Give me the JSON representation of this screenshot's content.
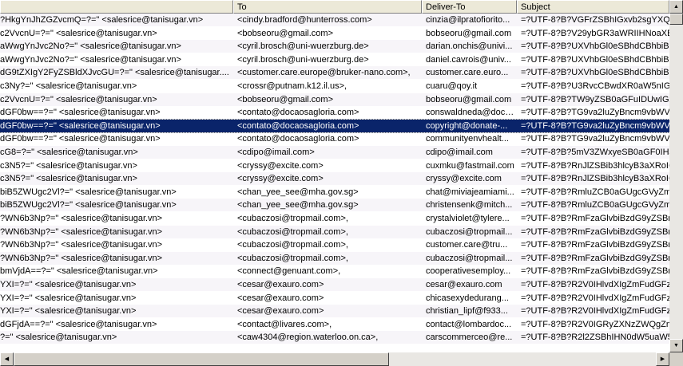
{
  "columns": [
    {
      "label": ""
    },
    {
      "label": "To"
    },
    {
      "label": "Deliver-To"
    },
    {
      "label": "Subject"
    }
  ],
  "rows": [
    {
      "from": "?HkgYnJhZGZvcmQ=?=\" <salesrice@tanisugar.vn>",
      "to": "<cindy.bradford@hunterross.com>",
      "deliver_to": "cinzia@ilpratofiorito...",
      "subject": "=?UTF-8?B?VGFrZSBhIGxvb2sgYXQgb"
    },
    {
      "from": "c2VvcnU=?=\" <salesrice@tanisugar.vn>",
      "to": "<bobseoru@gmail.com>",
      "deliver_to": "bobseoru@gmail.com",
      "subject": "=?UTF-8?B?V29ybGR3aWRIIHNoaXBwa"
    },
    {
      "from": "aWwgYnJvc2No?=\" <salesrice@tanisugar.vn>",
      "to": "<cyril.brosch@uni-wuerzburg.de>",
      "deliver_to": "darian.onchis@univi...",
      "subject": "=?UTF-8?B?UXVhbGl0eSBhdCBhbiBhZ"
    },
    {
      "from": "aWwgYnJvc2No?=\" <salesrice@tanisugar.vn>",
      "to": "<cyril.brosch@uni-wuerzburg.de>",
      "deliver_to": "daniel.cavrois@univ...",
      "subject": "=?UTF-8?B?UXVhbGl0eSBhdCBhbiBhZ"
    },
    {
      "from": "dG9tZXIgY2FyZSBldXJvcGU=?=\" <salesrice@tanisugar....",
      "to": "<customer.care.europe@bruker-nano.com>,",
      "deliver_to": "customer.care.euro...",
      "subject": "=?UTF-8?B?UXVhbGl0eSBhdCBhbiBhZ"
    },
    {
      "from": "c3Ny?=\" <salesrice@tanisugar.vn>",
      "to": "<crossr@putnam.k12.il.us>,",
      "deliver_to": "cuaru@qoy.it",
      "subject": "=?UTF-8?B?U3RvcCBwdXR0aW5nIGl0"
    },
    {
      "from": "c2VvcnU=?=\" <salesrice@tanisugar.vn>",
      "to": "<bobseoru@gmail.com>",
      "deliver_to": "bobseoru@gmail.com",
      "subject": "=?UTF-8?B?TW9yZSB0aGFuIDUwIGx"
    },
    {
      "from": "dGF0bw==?=\" <salesrice@tanisugar.vn>",
      "to": "<contato@docaosagloria.com>",
      "deliver_to": "conswaldneda@doca...",
      "subject": "=?UTF-8?B?TG9va2luZyBncm9vbWVk"
    },
    {
      "from": "dGF0bw==?=\" <salesrice@tanisugar.vn>",
      "to": "<contato@docaosagloria.com>",
      "deliver_to": "copyright@donate-...",
      "subject": "=?UTF-8?B?TG9va2luZyBncm9vbWVk"
    },
    {
      "from": "dGF0bw==?=\" <salesrice@tanisugar.vn>",
      "to": "<contato@docaosagloria.com>",
      "deliver_to": "communityenvhealt...",
      "subject": "=?UTF-8?B?TG9va2luZyBncm9vbWVk"
    },
    {
      "from": "cG8=?=\" <salesrice@tanisugar.vn>",
      "to": "<cdipo@imail.com>",
      "deliver_to": "cdipo@imail.com",
      "subject": "=?UTF-8?B?5mV3ZWxyeSB0aGF0IHJl"
    },
    {
      "from": "c3N5?=\" <salesrice@tanisugar.vn>",
      "to": "<cryssy@excite.com>",
      "deliver_to": "cuxmku@fastmail.com",
      "subject": "=?UTF-8?B?RnJlZSBib3hlcyB3aXRoIGl"
    },
    {
      "from": "c3N5?=\" <salesrice@tanisugar.vn>",
      "to": "<cryssy@excite.com>",
      "deliver_to": "cryssy@excite.com",
      "subject": "=?UTF-8?B?RnJlZSBib3hlcyB3aXRoIGl"
    },
    {
      "from": "biB5ZWUgc2Vl?=\" <salesrice@tanisugar.vn>",
      "to": "<chan_yee_see@mha.gov.sg>",
      "deliver_to": "chat@miviajeamiami...",
      "subject": "=?UTF-8?B?RmluZCB0aGUgcGVyZmVj"
    },
    {
      "from": "biB5ZWUgc2Vl?=\" <salesrice@tanisugar.vn>",
      "to": "<chan_yee_see@mha.gov.sg>",
      "deliver_to": "christensenk@mitch...",
      "subject": "=?UTF-8?B?RmluZCB0aGUgcGVyZmVj"
    },
    {
      "from": "?WN6b3Np?=\" <salesrice@tanisugar.vn>",
      "to": "<cubaczosi@tropmail.com>,",
      "deliver_to": "crystalviolet@tylere...",
      "subject": "=?UTF-8?B?RmFzaGlvbiBzdG9yZSBnY"
    },
    {
      "from": "?WN6b3Np?=\" <salesrice@tanisugar.vn>",
      "to": "<cubaczosi@tropmail.com>,",
      "deliver_to": "cubaczosi@tropmail...",
      "subject": "=?UTF-8?B?RmFzaGlvbiBzdG9yZSBnY"
    },
    {
      "from": "?WN6b3Np?=\" <salesrice@tanisugar.vn>",
      "to": "<cubaczosi@tropmail.com>,",
      "deliver_to": "customer.care@tru...",
      "subject": "=?UTF-8?B?RmFzaGlvbiBzdG9yZSBnY"
    },
    {
      "from": "?WN6b3Np?=\" <salesrice@tanisugar.vn>",
      "to": "<cubaczosi@tropmail.com>,",
      "deliver_to": "cubaczosi@tropmail...",
      "subject": "=?UTF-8?B?RmFzaGlvbiBzdG9yZSBnY"
    },
    {
      "from": "bmVjdA==?=\" <salesrice@tanisugar.vn>",
      "to": "<connect@genuant.com>,",
      "deliver_to": "cooperativesemploy...",
      "subject": "=?UTF-8?B?RmFzaGlvbiBzdG9yZSBnY"
    },
    {
      "from": "YXI=?=\" <salesrice@tanisugar.vn>",
      "to": "<cesar@exauro.com>",
      "deliver_to": "cesar@exauro.com",
      "subject": "=?UTF-8?B?R2V0IHlvdXIgZmFudGFzd"
    },
    {
      "from": "YXI=?=\" <salesrice@tanisugar.vn>",
      "to": "<cesar@exauro.com>",
      "deliver_to": "chicasexydedurang...",
      "subject": "=?UTF-8?B?R2V0IHlvdXIgZmFudGFzd"
    },
    {
      "from": "YXI=?=\" <salesrice@tanisugar.vn>",
      "to": "<cesar@exauro.com>",
      "deliver_to": "christian_lipf@f933...",
      "subject": "=?UTF-8?B?R2V0IHlvdXIgZmFudGFzd"
    },
    {
      "from": "dGFjdA==?=\" <salesrice@tanisugar.vn>",
      "to": "<contact@livares.com>,",
      "deliver_to": "contact@lombardoc...",
      "subject": "=?UTF-8?B?R2V0IGRyZXNzZWQgZm9"
    },
    {
      "from": "?=\" <salesrice@tanisugar.vn>",
      "to": "<caw4304@region.waterloo.on.ca>,",
      "deliver_to": "carscommerceo@re...",
      "subject": "=?UTF-8?B?R2l2ZSBhIHN0dW5uaW5n"
    }
  ],
  "selected_row": 8
}
